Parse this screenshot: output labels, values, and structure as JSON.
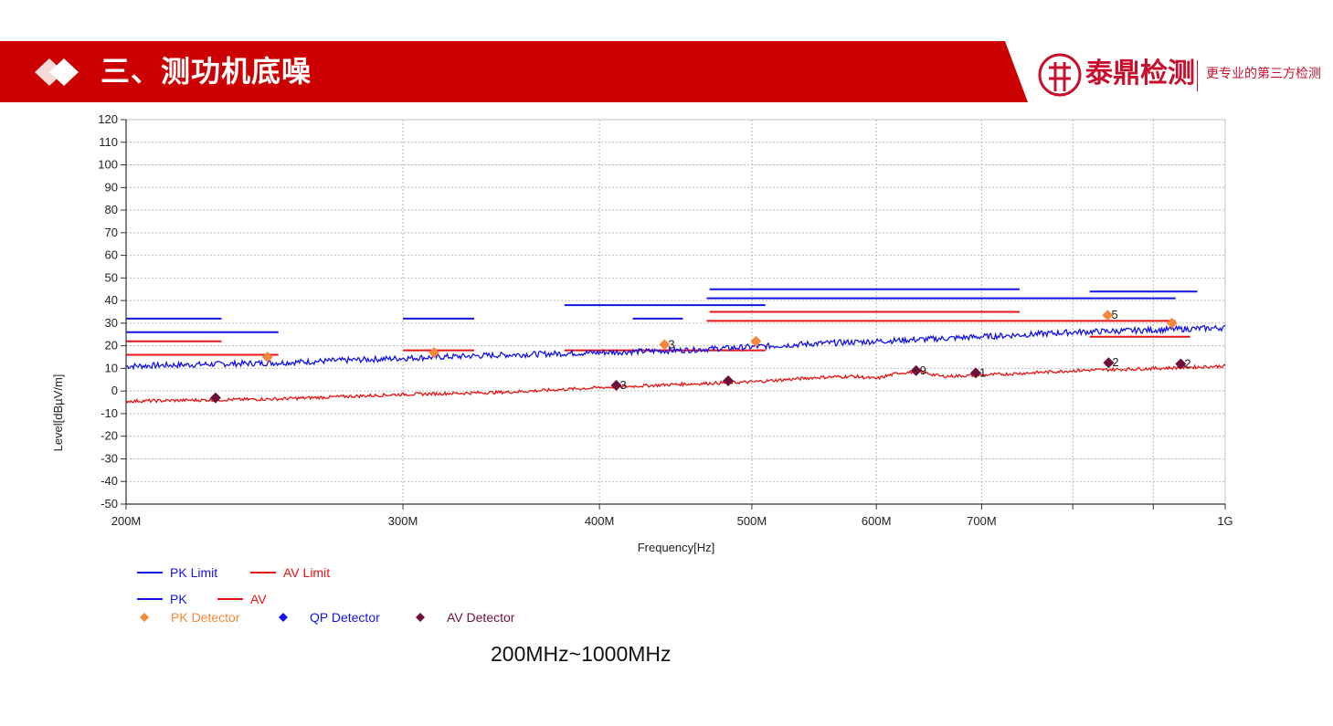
{
  "header": {
    "title": "三、测功机底噪",
    "brand_name": "泰鼎检测",
    "brand_slogan": "更专业的第三方检测",
    "colors": {
      "banner": "#cc0000",
      "brand": "#c8102e"
    }
  },
  "caption": "200MHz~1000MHz",
  "chart_data": {
    "type": "line",
    "xlabel": "Frequency[Hz]",
    "ylabel": "Level[dBµV/m]",
    "x_scale": "log",
    "xlim": [
      200000000,
      1000000000
    ],
    "ylim": [
      -50,
      120
    ],
    "grid": true,
    "x_ticks": [
      {
        "value": 200000000,
        "label": "200M"
      },
      {
        "value": 300000000,
        "label": "300M"
      },
      {
        "value": 400000000,
        "label": "400M"
      },
      {
        "value": 500000000,
        "label": "500M"
      },
      {
        "value": 600000000,
        "label": "600M"
      },
      {
        "value": 700000000,
        "label": "700M"
      },
      {
        "value": 800000000,
        "label": ""
      },
      {
        "value": 900000000,
        "label": ""
      },
      {
        "value": 1000000000,
        "label": "1G"
      }
    ],
    "y_ticks": [
      120,
      110,
      100,
      90,
      80,
      70,
      60,
      50,
      40,
      30,
      20,
      10,
      0,
      -10,
      -20,
      -30,
      -40,
      -50
    ],
    "limit_lines": [
      {
        "series": "PK Limit",
        "x": [
          200000000,
          230000000
        ],
        "y": 32
      },
      {
        "series": "PK Limit",
        "x": [
          200000000,
          250000000
        ],
        "y": 26
      },
      {
        "series": "PK Limit",
        "x": [
          300000000,
          333000000
        ],
        "y": 32
      },
      {
        "series": "PK Limit",
        "x": [
          380000000,
          510000000
        ],
        "y": 38
      },
      {
        "series": "PK Limit",
        "x": [
          420000000,
          452000000
        ],
        "y": 32
      },
      {
        "series": "PK Limit",
        "x": [
          470000000,
          740000000
        ],
        "y": 45
      },
      {
        "series": "PK Limit",
        "x": [
          468000000,
          930000000
        ],
        "y": 41
      },
      {
        "series": "PK Limit",
        "x": [
          820000000,
          960000000
        ],
        "y": 44
      },
      {
        "series": "AV Limit",
        "x": [
          200000000,
          230000000
        ],
        "y": 22
      },
      {
        "series": "AV Limit",
        "x": [
          200000000,
          250000000
        ],
        "y": 16
      },
      {
        "series": "AV Limit",
        "x": [
          300000000,
          333000000
        ],
        "y": 18
      },
      {
        "series": "AV Limit",
        "x": [
          380000000,
          510000000
        ],
        "y": 18
      },
      {
        "series": "AV Limit",
        "x": [
          470000000,
          740000000
        ],
        "y": 35
      },
      {
        "series": "AV Limit",
        "x": [
          468000000,
          930000000
        ],
        "y": 31
      },
      {
        "series": "AV Limit",
        "x": [
          820000000,
          950000000
        ],
        "y": 24
      }
    ],
    "traces": [
      {
        "name": "PK",
        "color": "#1414e6",
        "x": [
          200000000,
          250000000,
          300000000,
          350000000,
          400000000,
          450000000,
          500000000,
          550000000,
          600000000,
          650000000,
          700000000,
          750000000,
          800000000,
          850000000,
          900000000,
          950000000,
          1000000000
        ],
        "y": [
          11,
          12.5,
          14.5,
          16,
          17,
          18,
          19.5,
          21,
          22,
          23,
          24,
          25,
          26,
          26.5,
          27,
          27.5,
          28
        ]
      },
      {
        "name": "AV",
        "color": "#e61414",
        "x": [
          200000000,
          250000000,
          300000000,
          350000000,
          400000000,
          450000000,
          500000000,
          550000000,
          580000000,
          600000000,
          620000000,
          640000000,
          660000000,
          700000000,
          750000000,
          800000000,
          850000000,
          900000000,
          950000000,
          1000000000
        ],
        "y": [
          -4.5,
          -3.5,
          -1.5,
          -0.5,
          1.5,
          3,
          4,
          6,
          6.5,
          5.5,
          8,
          8.5,
          6.5,
          7,
          8,
          9,
          9.5,
          10,
          10.5,
          11
        ]
      }
    ],
    "markers": [
      {
        "series": "PK Detector",
        "x": 246000000,
        "y": 15,
        "label": ""
      },
      {
        "series": "PK Detector",
        "x": 314000000,
        "y": 17,
        "label": ""
      },
      {
        "series": "PK Detector",
        "x": 440000000,
        "y": 20.5,
        "label": "3"
      },
      {
        "series": "PK Detector",
        "x": 503000000,
        "y": 22,
        "label": ""
      },
      {
        "series": "PK Detector",
        "x": 842000000,
        "y": 33.5,
        "label": "5"
      },
      {
        "series": "PK Detector",
        "x": 925000000,
        "y": 30,
        "label": ""
      },
      {
        "series": "AV Detector",
        "x": 228000000,
        "y": -3,
        "label": ""
      },
      {
        "series": "AV Detector",
        "x": 410000000,
        "y": 2.5,
        "label": "3"
      },
      {
        "series": "AV Detector",
        "x": 483000000,
        "y": 4.5,
        "label": ""
      },
      {
        "series": "AV Detector",
        "x": 636000000,
        "y": 9,
        "label": "9"
      },
      {
        "series": "AV Detector",
        "x": 694000000,
        "y": 8,
        "label": "1"
      },
      {
        "series": "AV Detector",
        "x": 843000000,
        "y": 12.5,
        "label": "2"
      },
      {
        "series": "AV Detector",
        "x": 937000000,
        "y": 12,
        "label": "2"
      }
    ],
    "legend": [
      {
        "label": "PK Limit",
        "kind": "line",
        "color": "#1414e6"
      },
      {
        "label": "AV Limit",
        "kind": "line",
        "color": "#e61414"
      },
      {
        "label": "PK",
        "kind": "line",
        "color": "#1414e6"
      },
      {
        "label": "AV",
        "kind": "line",
        "color": "#e61414"
      },
      {
        "label": "PK Detector",
        "kind": "diamond",
        "color": "#f5883c"
      },
      {
        "label": "QP Detector",
        "kind": "diamond",
        "color": "#1414e6"
      },
      {
        "label": "AV Detector",
        "kind": "diamond",
        "color": "#6e0f3c"
      }
    ],
    "legend_position": "bottom-left"
  }
}
